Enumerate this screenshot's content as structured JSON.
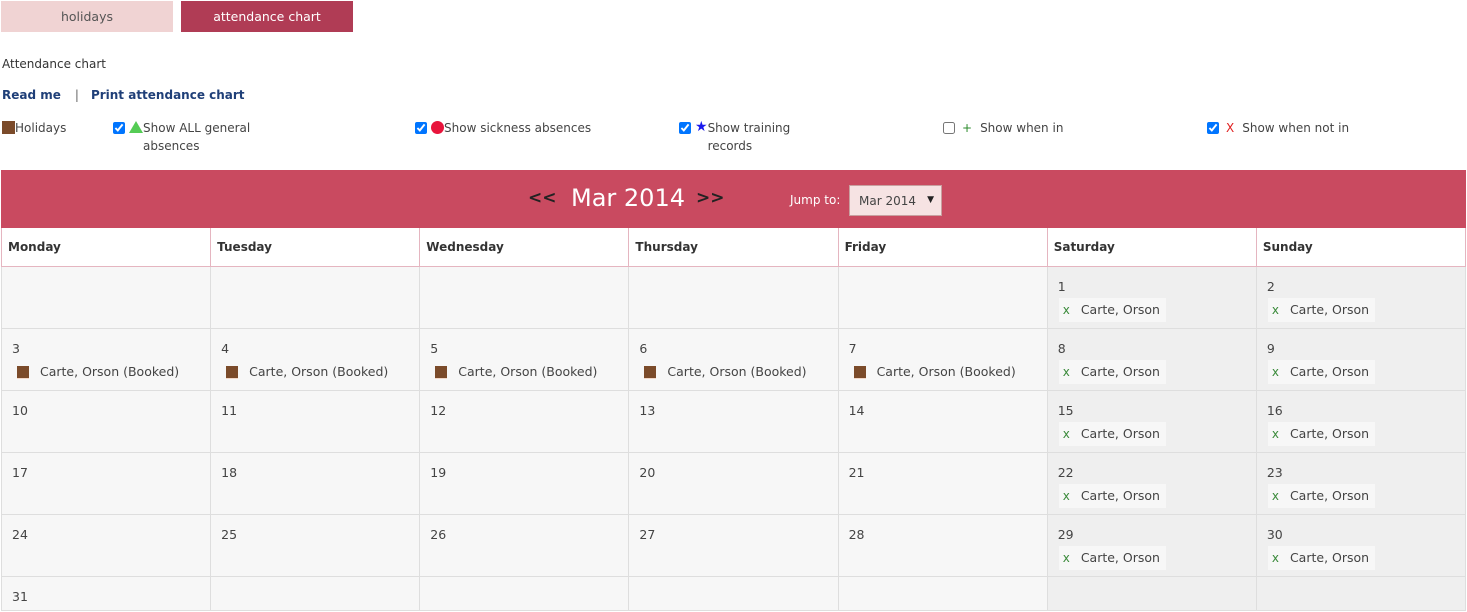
{
  "tabs": [
    {
      "label": "holidays",
      "active": false
    },
    {
      "label": "attendance chart",
      "active": true
    }
  ],
  "page_heading": "Attendance chart",
  "links": {
    "read_me": "Read me",
    "separator": "|",
    "print": "Print attendance chart"
  },
  "legend": {
    "holidays": {
      "label": "Holidays",
      "color": "#7b4b2a"
    },
    "general": {
      "label": "Show ALL general absences",
      "checked": true,
      "icon": "green-triangle-icon",
      "color": "#55cc55"
    },
    "sickness": {
      "label": "Show sickness absences",
      "checked": true,
      "icon": "red-dot-icon",
      "color": "#e8153c"
    },
    "training": {
      "label": "Show training records",
      "checked": true,
      "icon": "blue-star-icon",
      "glyph": "★",
      "color": "#1a1aee"
    },
    "when_in": {
      "label": "Show when in",
      "checked": false,
      "icon": "plus-icon",
      "glyph": "+",
      "color": "#2a8a2a"
    },
    "not_in": {
      "label": "Show when not in",
      "checked": true,
      "icon": "x-icon",
      "glyph": "X",
      "color": "#e02020"
    }
  },
  "calendar": {
    "prev": "<<",
    "next": ">>",
    "month_title": "Mar 2014",
    "jump_label": "Jump to:",
    "jump_value": "Mar 2014",
    "header_color": "#c94a60",
    "days": [
      "Monday",
      "Tuesday",
      "Wednesday",
      "Thursday",
      "Friday",
      "Saturday",
      "Sunday"
    ],
    "weeks": [
      [
        null,
        null,
        null,
        null,
        null,
        {
          "day": "1",
          "entries": [
            {
              "type": "notin",
              "mark": "x",
              "text": "Carte, Orson"
            }
          ]
        },
        {
          "day": "2",
          "entries": [
            {
              "type": "notin",
              "mark": "x",
              "text": "Carte, Orson"
            }
          ]
        }
      ],
      [
        {
          "day": "3",
          "entries": [
            {
              "type": "booked",
              "text": "Carte, Orson (Booked)"
            }
          ]
        },
        {
          "day": "4",
          "entries": [
            {
              "type": "booked",
              "text": "Carte, Orson (Booked)"
            }
          ]
        },
        {
          "day": "5",
          "entries": [
            {
              "type": "booked",
              "text": "Carte, Orson (Booked)"
            }
          ]
        },
        {
          "day": "6",
          "entries": [
            {
              "type": "booked",
              "text": "Carte, Orson (Booked)"
            }
          ]
        },
        {
          "day": "7",
          "entries": [
            {
              "type": "booked",
              "text": "Carte, Orson (Booked)"
            }
          ]
        },
        {
          "day": "8",
          "entries": [
            {
              "type": "notin",
              "mark": "x",
              "text": "Carte, Orson"
            }
          ]
        },
        {
          "day": "9",
          "entries": [
            {
              "type": "notin",
              "mark": "x",
              "text": "Carte, Orson"
            }
          ]
        }
      ],
      [
        {
          "day": "10",
          "entries": []
        },
        {
          "day": "11",
          "entries": []
        },
        {
          "day": "12",
          "entries": []
        },
        {
          "day": "13",
          "entries": []
        },
        {
          "day": "14",
          "entries": []
        },
        {
          "day": "15",
          "entries": [
            {
              "type": "notin",
              "mark": "x",
              "text": "Carte, Orson"
            }
          ]
        },
        {
          "day": "16",
          "entries": [
            {
              "type": "notin",
              "mark": "x",
              "text": "Carte, Orson"
            }
          ]
        }
      ],
      [
        {
          "day": "17",
          "entries": []
        },
        {
          "day": "18",
          "entries": []
        },
        {
          "day": "19",
          "entries": []
        },
        {
          "day": "20",
          "entries": []
        },
        {
          "day": "21",
          "entries": []
        },
        {
          "day": "22",
          "entries": [
            {
              "type": "notin",
              "mark": "x",
              "text": "Carte, Orson"
            }
          ]
        },
        {
          "day": "23",
          "entries": [
            {
              "type": "notin",
              "mark": "x",
              "text": "Carte, Orson"
            }
          ]
        }
      ],
      [
        {
          "day": "24",
          "entries": []
        },
        {
          "day": "25",
          "entries": []
        },
        {
          "day": "26",
          "entries": []
        },
        {
          "day": "27",
          "entries": []
        },
        {
          "day": "28",
          "entries": []
        },
        {
          "day": "29",
          "entries": [
            {
              "type": "notin",
              "mark": "x",
              "text": "Carte, Orson"
            }
          ]
        },
        {
          "day": "30",
          "entries": [
            {
              "type": "notin",
              "mark": "x",
              "text": "Carte, Orson"
            }
          ]
        }
      ],
      [
        {
          "day": "31",
          "entries": []
        },
        null,
        null,
        null,
        null,
        null,
        null
      ]
    ]
  }
}
